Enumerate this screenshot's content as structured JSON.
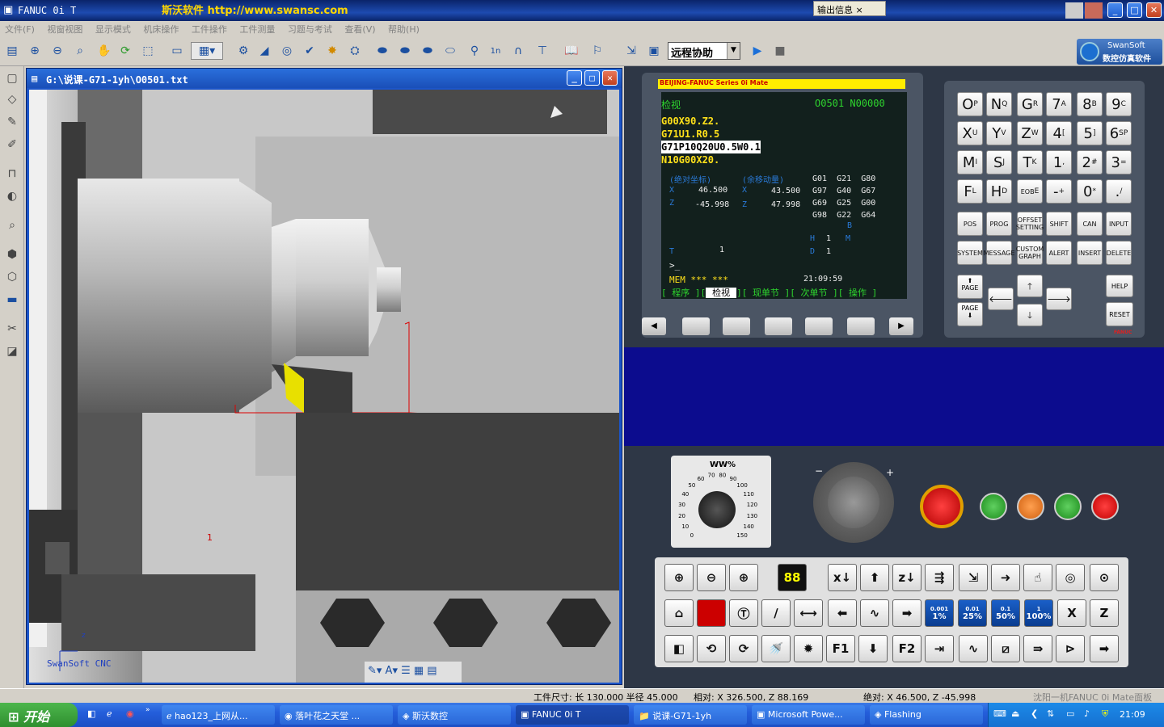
{
  "app": {
    "title": "FANUC 0i T",
    "banner": "斯沃软件 http://www.swansc.com",
    "output_tab": "输出信息"
  },
  "menu": [
    "文件(F)",
    "视窗视图",
    "显示模式",
    "机床操作",
    "工件操作",
    "工件测量",
    "习题与考试",
    "查看(V)",
    "帮助(H)"
  ],
  "toolbar": {
    "combo_value": "远程协助",
    "brand_line1": "SwanSoft",
    "brand_line2": "数控仿真软件"
  },
  "viewport": {
    "title": "G:\\说课-G71-1yh\\O0501.txt",
    "watermark": "SwanSoft CNC",
    "marker": "1",
    "axis_x": "x",
    "axis_z": "z"
  },
  "lcd": {
    "header": "BEIJING-FANUC Series 0i Mate",
    "mode": "检视",
    "program": "O0501 N00000",
    "lines": [
      "G00X90.Z2.",
      "G71U1.R0.5",
      "G71P10Q20U0.5W0.1",
      "N10G00X20."
    ],
    "abs_label": "(绝对坐标)",
    "dist_label": "(余移动量)",
    "abs": {
      "x_label": "X",
      "x": "46.500",
      "z_label": "Z",
      "z": "-45.998"
    },
    "dist": {
      "x_label": "X",
      "x": "43.500",
      "z_label": "Z",
      "z": "47.998"
    },
    "gcodes": [
      [
        "G01",
        "G21",
        "G80"
      ],
      [
        "G97",
        "G40",
        "G67"
      ],
      [
        "G69",
        "G25",
        "G00"
      ],
      [
        "G98",
        "G22",
        "G64"
      ]
    ],
    "b_label": "B",
    "h_label": "H",
    "h": "1",
    "m_label": "M",
    "d_label": "D",
    "d": "1",
    "t_label": "T",
    "t": "1",
    "prompt": ">_",
    "status": "MEM *** ***",
    "time": "21:09:59",
    "softkeys": [
      "程序",
      "检视",
      "现单节",
      "次单节",
      "操作"
    ]
  },
  "keypad": {
    "rows": [
      [
        "O P",
        "N Q",
        "G R",
        "7 A",
        "8 B",
        "9 C"
      ],
      [
        "X U",
        "Y V",
        "Z W",
        "4 [",
        "5 ]",
        "6 SP"
      ],
      [
        "M I",
        "S J",
        "T K",
        "1 ,",
        "2 #",
        "3 ="
      ],
      [
        "F L",
        "H D",
        "EOB E",
        "- +",
        "0 *",
        ". /"
      ]
    ],
    "func1": [
      "POS",
      "PROG",
      "OFFSET SETTING",
      "SHIFT",
      "CAN",
      "INPUT"
    ],
    "func2": [
      "SYSTEM",
      "MESSAGE",
      "CUSTOM GRAPH",
      "ALERT",
      "INSERT",
      "DELETE"
    ],
    "page_up": "PAGE",
    "page_down": "PAGE",
    "help": "HELP",
    "reset": "RESET",
    "fanuc": "FANUC"
  },
  "feed": {
    "title": "WW%",
    "ticks": [
      "0",
      "10",
      "20",
      "30",
      "40",
      "50",
      "60",
      "70",
      "80",
      "90",
      "100",
      "110",
      "120",
      "130",
      "140",
      "150"
    ]
  },
  "machine_keys": {
    "display_value": "88",
    "rate_keys": [
      [
        "0.001",
        "1%"
      ],
      [
        "0.01",
        "25%"
      ],
      [
        "0.1",
        "50%"
      ],
      [
        "1",
        "100%"
      ]
    ],
    "f1": "F1",
    "f2": "F2",
    "x": "X",
    "z": "Z"
  },
  "status": {
    "size": "工件尺寸: 长 130.000 半径  45.000",
    "rel": "相对: X 326.500, Z  88.169",
    "abs": "绝对: X  46.500, Z -45.998",
    "machine": "沈阳一机FANUC 0i Mate面板"
  },
  "taskbar": {
    "start": "开始",
    "tasks": [
      "hao123_上网从...",
      "落叶花之天堂 ...",
      "斯沃数控",
      "FANUC 0i T",
      "说课-G71-1yh",
      "Microsoft Powe...",
      "Flashing"
    ],
    "clock": "21:09"
  }
}
